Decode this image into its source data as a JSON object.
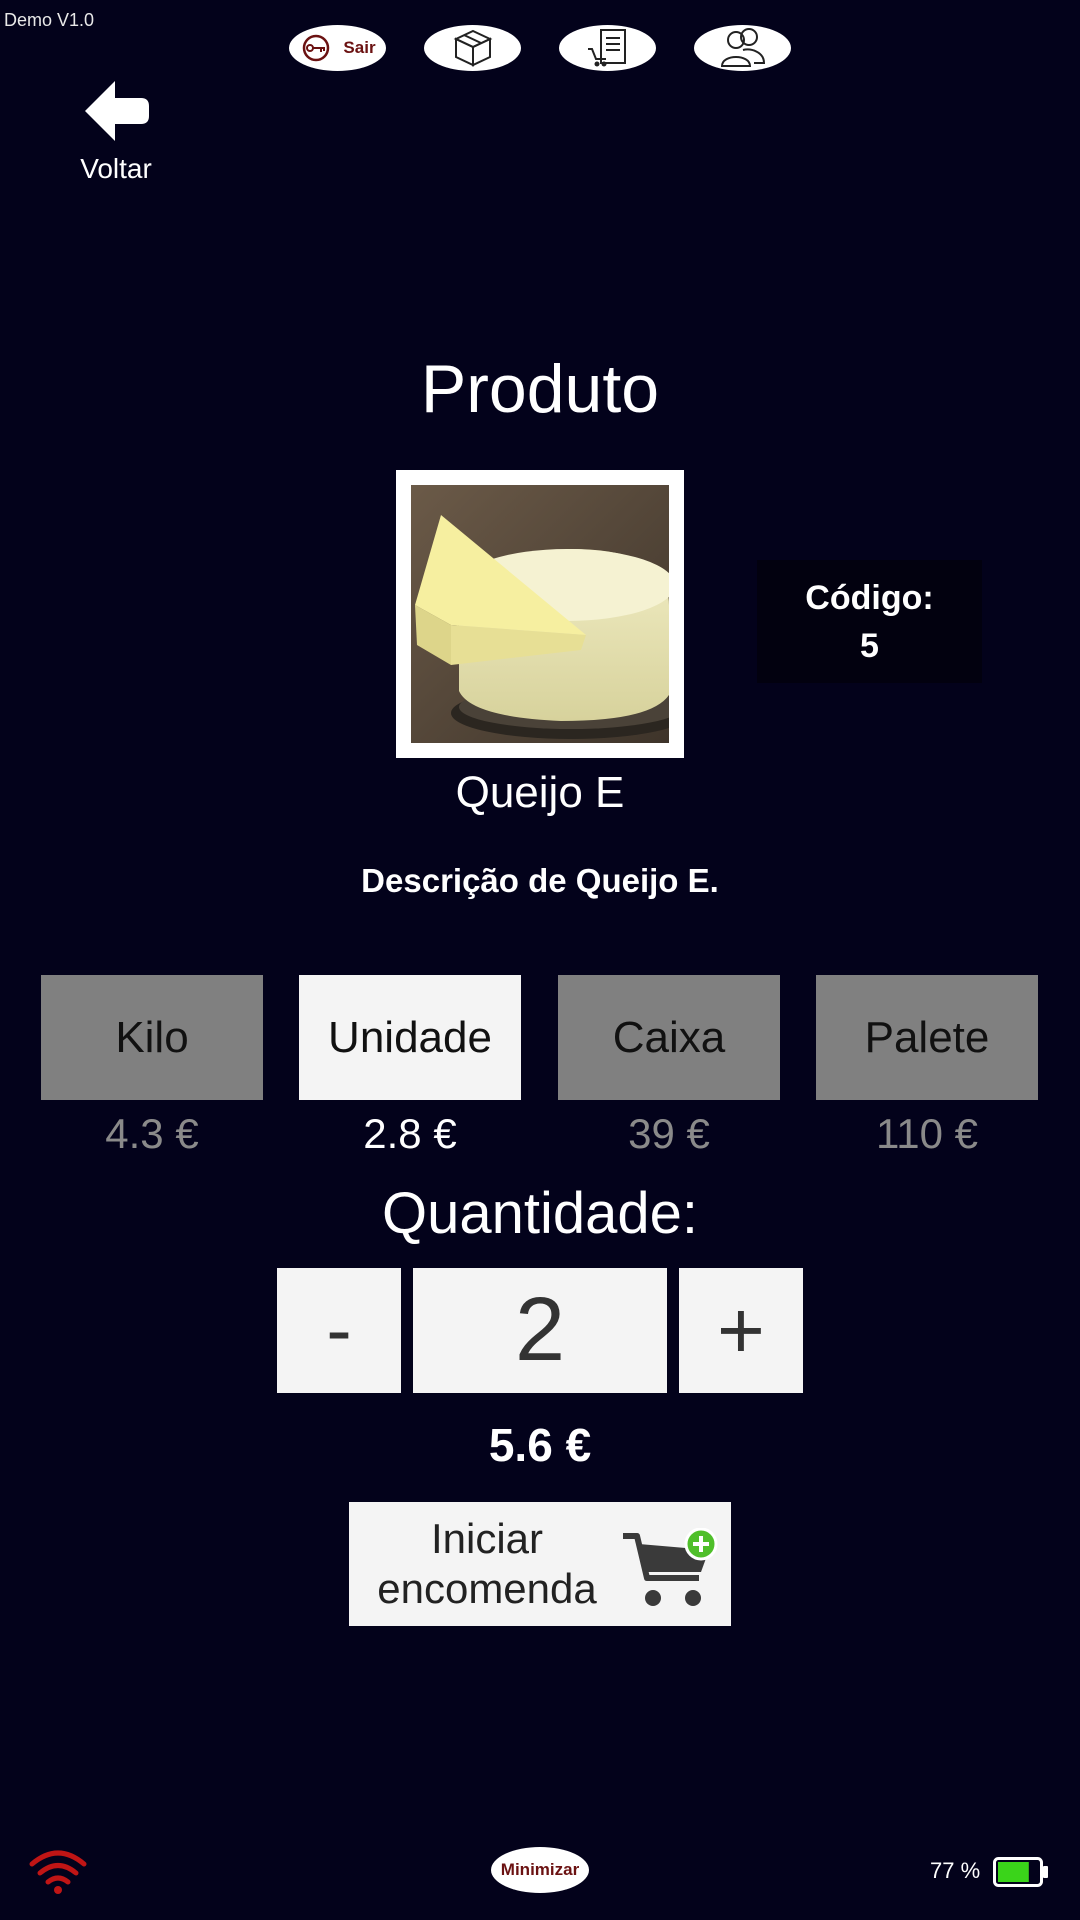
{
  "app": {
    "version": "Demo V1.0"
  },
  "topbar": {
    "exit_label": "Sair"
  },
  "nav": {
    "back_label": "Voltar"
  },
  "page": {
    "title": "Produto"
  },
  "product": {
    "code_label": "Código:",
    "code_value": "5",
    "name": "Queijo E",
    "description": "Descrição de Queijo E."
  },
  "units": [
    {
      "label": "Kilo",
      "price": "4.3 €",
      "selected": false
    },
    {
      "label": "Unidade",
      "price": "2.8 €",
      "selected": true
    },
    {
      "label": "Caixa",
      "price": "39 €",
      "selected": false
    },
    {
      "label": "Palete",
      "price": "110 €",
      "selected": false
    }
  ],
  "quantity": {
    "label": "Quantidade:",
    "minus_label": "-",
    "value": "2",
    "plus_label": "+"
  },
  "total": "5.6 €",
  "order_button": {
    "line1": "Iniciar",
    "line2": "encomenda"
  },
  "statusbar": {
    "minimize_label": "Minimizar",
    "battery_percent": "77 %",
    "battery_level": 0.77
  },
  "colors": {
    "background": "#03021b",
    "selected_unit": "#f4f4f4",
    "unselected_unit": "#808080",
    "wifi": "#c01515",
    "battery_fill": "#3ad41a"
  },
  "icons": [
    "key-icon",
    "box-icon",
    "cart-document-icon",
    "users-icon",
    "back-arrow-icon",
    "cart-add-icon",
    "wifi-icon",
    "battery-icon"
  ]
}
